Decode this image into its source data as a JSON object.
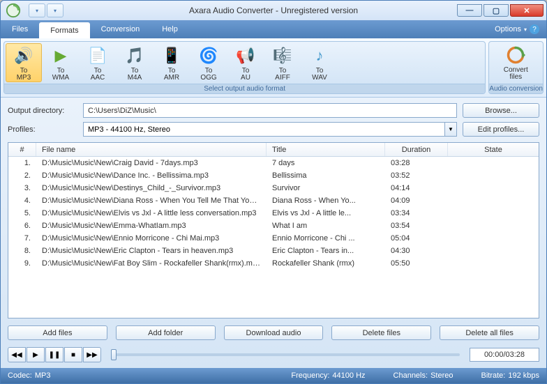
{
  "title": "Axara Audio Converter - Unregistered version",
  "menu": {
    "files": "Files",
    "formats": "Formats",
    "conversion": "Conversion",
    "help": "Help",
    "options": "Options"
  },
  "ribbon": {
    "group1_caption": "Select output audio format",
    "group2_caption": "Audio conversion",
    "convert": "Convert\nfiles",
    "formats": [
      {
        "l1": "To",
        "l2": "MP3"
      },
      {
        "l1": "To",
        "l2": "WMA"
      },
      {
        "l1": "To",
        "l2": "AAC"
      },
      {
        "l1": "To",
        "l2": "M4A"
      },
      {
        "l1": "To",
        "l2": "AMR"
      },
      {
        "l1": "To",
        "l2": "OGG"
      },
      {
        "l1": "To",
        "l2": "AU"
      },
      {
        "l1": "To",
        "l2": "AIFF"
      },
      {
        "l1": "To",
        "l2": "WAV"
      }
    ]
  },
  "outdir_label": "Output directory:",
  "outdir_value": "C:\\Users\\DiZ\\Music\\",
  "browse": "Browse...",
  "profiles_label": "Profiles:",
  "profile_value": "MP3 - 44100 Hz, Stereo",
  "edit_profiles": "Edit profiles...",
  "columns": {
    "n": "#",
    "file": "File name",
    "title": "Title",
    "dur": "Duration",
    "state": "State"
  },
  "rows": [
    {
      "n": "1.",
      "file": "D:\\Music\\Music\\New\\Craig David - 7days.mp3",
      "title": "7 days",
      "dur": "03:28",
      "state": ""
    },
    {
      "n": "2.",
      "file": "D:\\Music\\Music\\New\\Dance Inc. - Bellissima.mp3",
      "title": "Bellissima",
      "dur": "03:52",
      "state": ""
    },
    {
      "n": "3.",
      "file": "D:\\Music\\Music\\New\\Destinys_Child_-_Survivor.mp3",
      "title": "Survivor",
      "dur": "04:14",
      "state": ""
    },
    {
      "n": "4.",
      "file": "D:\\Music\\Music\\New\\Diana Ross - When You Tell Me That You ...",
      "title": "Diana Ross - When Yo...",
      "dur": "04:09",
      "state": ""
    },
    {
      "n": "5.",
      "file": "D:\\Music\\Music\\New\\Elvis vs Jxl - A little less conversation.mp3",
      "title": "Elvis vs Jxl - A little le...",
      "dur": "03:34",
      "state": ""
    },
    {
      "n": "6.",
      "file": "D:\\Music\\Music\\New\\Emma-WhatIam.mp3",
      "title": "What I am",
      "dur": "03:54",
      "state": ""
    },
    {
      "n": "7.",
      "file": "D:\\Music\\Music\\New\\Ennio Morricone - Chi Mai.mp3",
      "title": "Ennio Morricone - Chi ...",
      "dur": "05:04",
      "state": ""
    },
    {
      "n": "8.",
      "file": "D:\\Music\\Music\\New\\Eric Clapton - Tears in heaven.mp3",
      "title": "Eric Clapton - Tears in...",
      "dur": "04:30",
      "state": ""
    },
    {
      "n": "9.",
      "file": "D:\\Music\\Music\\New\\Fat Boy Slim - Rockafeller Shank(rmx).mp3",
      "title": "Rockafeller Shank (rmx)",
      "dur": "05:50",
      "state": ""
    }
  ],
  "buttons": {
    "add_files": "Add files",
    "add_folder": "Add folder",
    "download": "Download audio",
    "delete": "Delete files",
    "delete_all": "Delete all files"
  },
  "time": "00:00/03:28",
  "status": {
    "codec_l": "Codec:",
    "codec_v": "MP3",
    "freq_l": "Frequency:",
    "freq_v": "44100 Hz",
    "ch_l": "Channels:",
    "ch_v": "Stereo",
    "br_l": "Bitrate:",
    "br_v": "192 kbps"
  }
}
